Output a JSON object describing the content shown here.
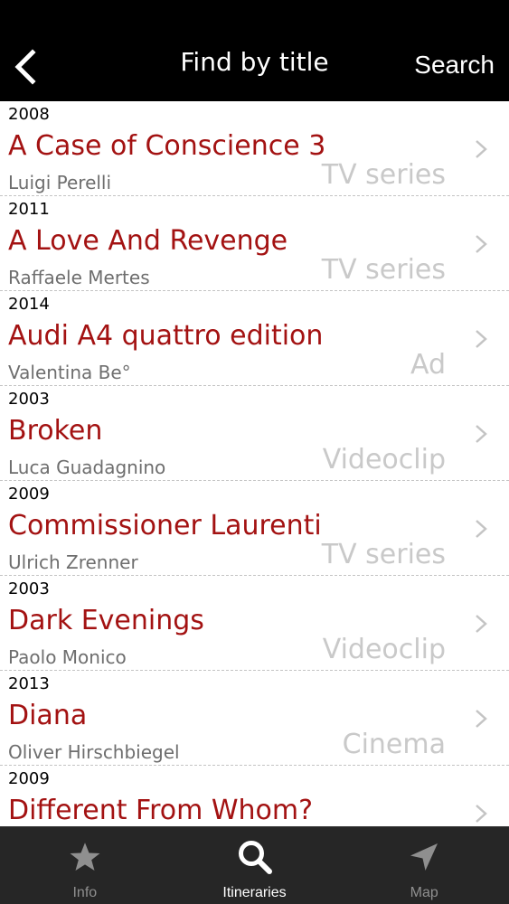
{
  "header": {
    "title": "Find by title",
    "search_label": "Search",
    "back_icon": "chevron-left-icon"
  },
  "colors": {
    "title_red": "#a31212",
    "navbar_bg": "#000000",
    "tabbar_bg": "#262626"
  },
  "films": [
    {
      "year": "2008",
      "title": "A Case of Conscience 3",
      "director": "Luigi Perelli",
      "type": "TV series"
    },
    {
      "year": "2011",
      "title": "A Love And Revenge",
      "director": "Raffaele Mertes",
      "type": "TV series"
    },
    {
      "year": "2014",
      "title": "Audi A4 quattro edition",
      "director": "Valentina Be°",
      "type": "Ad"
    },
    {
      "year": "2003",
      "title": "Broken",
      "director": "Luca Guadagnino",
      "type": "Videoclip"
    },
    {
      "year": "2009",
      "title": "Commissioner Laurenti",
      "director": "Ulrich Zrenner",
      "type": "TV series"
    },
    {
      "year": "2003",
      "title": "Dark Evenings",
      "director": "Paolo Monico",
      "type": "Videoclip"
    },
    {
      "year": "2013",
      "title": "Diana",
      "director": "Oliver Hirschbiegel",
      "type": "Cinema"
    },
    {
      "year": "2009",
      "title": "Different From Whom?",
      "director": "",
      "type": ""
    }
  ],
  "tabbar": {
    "tabs": [
      {
        "label": "Info",
        "icon": "star-icon",
        "active": false
      },
      {
        "label": "Itineraries",
        "icon": "search-icon",
        "active": true
      },
      {
        "label": "Map",
        "icon": "location-arrow-icon",
        "active": false
      }
    ]
  }
}
